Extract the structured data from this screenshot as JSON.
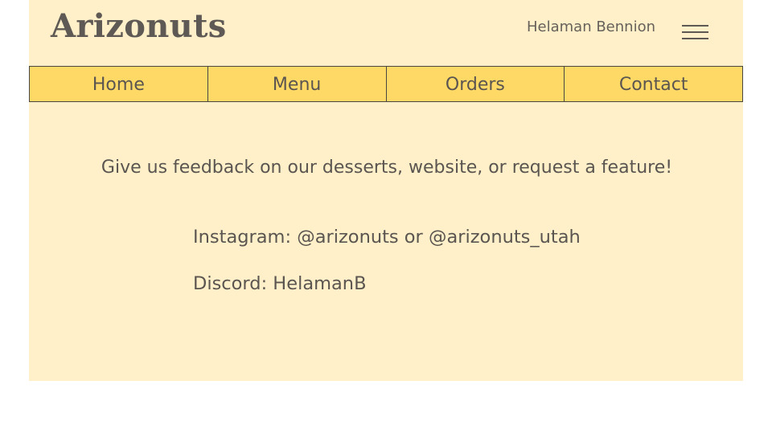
{
  "header": {
    "brand": "Arizonuts",
    "user_name": "Helaman Bennion",
    "menu_icon": "hamburger-menu-icon"
  },
  "nav": {
    "items": [
      {
        "label": "Home"
      },
      {
        "label": "Menu"
      },
      {
        "label": "Orders"
      },
      {
        "label": "Contact"
      }
    ]
  },
  "content": {
    "intro": "Give us feedback on our desserts, website, or request a feature!",
    "instagram": "Instagram: @arizonuts or @arizonuts_utah",
    "discord": "Discord: HelamanB"
  },
  "colors": {
    "page_background": "#fff0c9",
    "nav_background": "#ffd966",
    "text": "#5a5550"
  }
}
